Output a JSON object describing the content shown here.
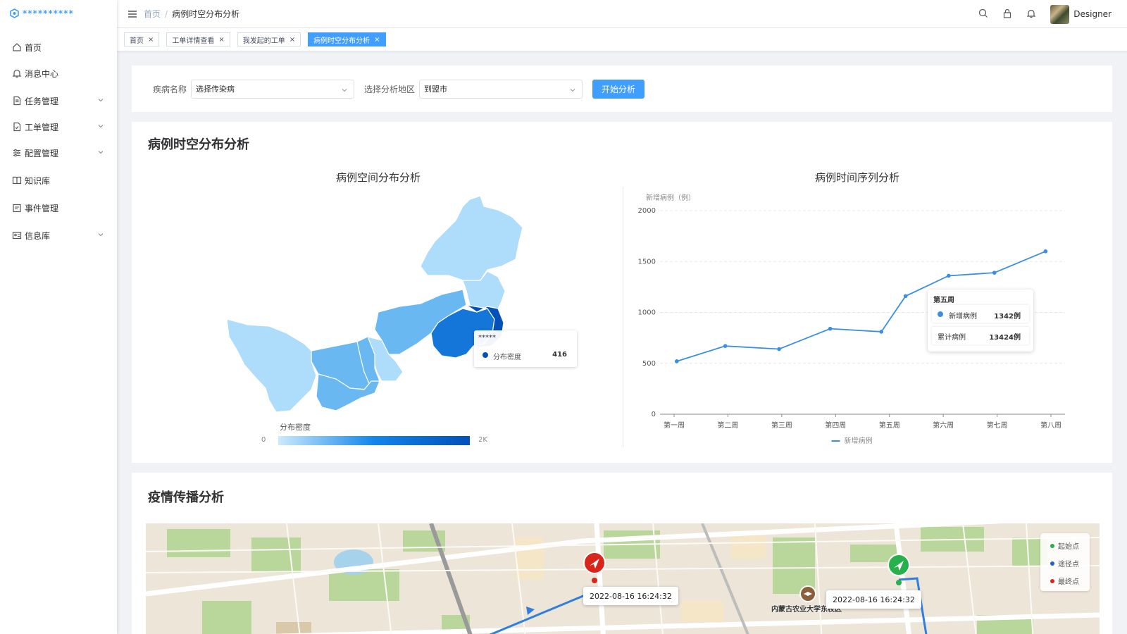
{
  "app": {
    "logo_text": "**********"
  },
  "sidebar": {
    "items": [
      {
        "label": "首页",
        "icon": "home-icon"
      },
      {
        "label": "消息中心",
        "icon": "bell-icon"
      },
      {
        "label": "任务管理",
        "icon": "document-icon",
        "expandable": true
      },
      {
        "label": "工单管理",
        "icon": "file-check-icon",
        "expandable": true
      },
      {
        "label": "配置管理",
        "icon": "sliders-icon",
        "expandable": true
      },
      {
        "label": "知识库",
        "icon": "book-icon"
      },
      {
        "label": "事件管理",
        "icon": "calendar-icon"
      },
      {
        "label": "信息库",
        "icon": "id-card-icon",
        "expandable": true
      }
    ]
  },
  "header": {
    "breadcrumb": [
      "首页",
      "病例时空分布分析"
    ],
    "user": "Designer"
  },
  "tags": [
    {
      "label": "首页",
      "active": false
    },
    {
      "label": "工单详情查看",
      "active": false
    },
    {
      "label": "我发起的工单",
      "active": false
    },
    {
      "label": "病例时空分布分析",
      "active": true
    }
  ],
  "filter": {
    "disease_label": "疾病名称",
    "disease_value": "选择传染病",
    "region_label": "选择分析地区",
    "region_value": "到盟市",
    "submit_label": "开始分析"
  },
  "analysis": {
    "title": "病例时空分布分析",
    "map": {
      "title": "病例空间分布分析",
      "visual_label": "分布密度",
      "min_label": "0",
      "max_label": "2K",
      "tooltip": {
        "region": "*****",
        "metric": "分布密度",
        "value": "416"
      },
      "colors": {
        "light": "#aedcfb",
        "mid": "#6ab8f2",
        "deep": "#1376d8",
        "deepest": "#0350b8"
      }
    },
    "timeseries": {
      "title": "病例时间序列分析",
      "tooltip": {
        "week": "第五周",
        "new_label": "新增病例",
        "new_value": "1342例",
        "cum_label": "累计病例",
        "cum_value": "13424例"
      }
    }
  },
  "chart_data": {
    "type": "line",
    "ylabel": "新增病例（例）",
    "categories": [
      "第一周",
      "第二周",
      "第三周",
      "第四周",
      "第五周",
      "第六周",
      "第七周",
      "第八周"
    ],
    "x": [
      0.05,
      0.95,
      1.95,
      2.9,
      3.85,
      4.3,
      5.1,
      5.95,
      6.9
    ],
    "series": [
      {
        "name": "新增病例",
        "values": [
          520,
          670,
          640,
          840,
          810,
          1160,
          1360,
          1390,
          1600
        ],
        "color": "#3a8ee6"
      }
    ],
    "ylim": [
      0,
      2000
    ],
    "yticks": [
      0,
      500,
      1000,
      1500,
      2000
    ],
    "grid": true,
    "legend": "bottom"
  },
  "spread": {
    "title": "疫情传播分析",
    "markers": [
      {
        "time": "2022-08-16 16:24:32"
      },
      {
        "time": "2022-08-16 16:24:32"
      }
    ],
    "poi": "内蒙古农业大学东校区",
    "legend": [
      {
        "label": "起始点",
        "color": "#27b04b"
      },
      {
        "label": "途径点",
        "color": "#2a5bd7"
      },
      {
        "label": "最终点",
        "color": "#d9261c"
      }
    ]
  }
}
